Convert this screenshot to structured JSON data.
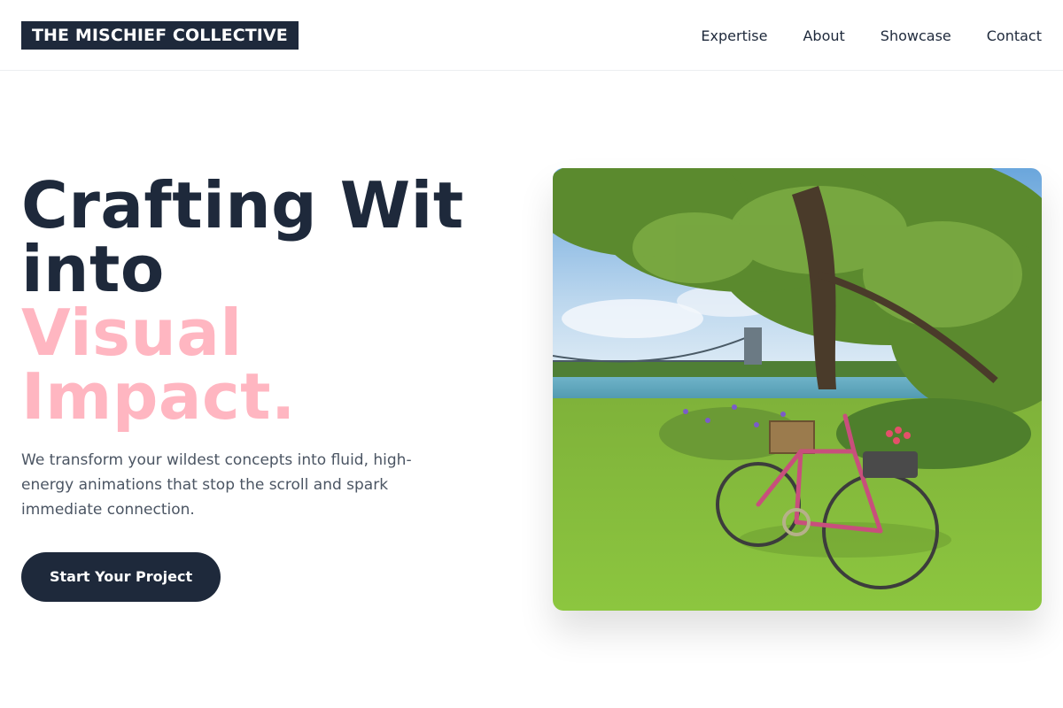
{
  "brand": {
    "name": "THE MISCHIEF COLLECTIVE"
  },
  "nav": {
    "items": [
      {
        "label": "Expertise"
      },
      {
        "label": "About"
      },
      {
        "label": "Showcase"
      },
      {
        "label": "Contact"
      }
    ]
  },
  "hero": {
    "headline_line1": "Crafting Wit",
    "headline_line2": "into",
    "headline_line3": "Visual",
    "headline_line4": "Impact.",
    "description": "We transform your wildest concepts into fluid, high-energy animations that stop the scroll and spark immediate connection.",
    "cta_label": "Start Your Project"
  },
  "colors": {
    "primary": "#1e293b",
    "accent_pink": "#ffb6c1",
    "body_text": "#4b5563"
  }
}
